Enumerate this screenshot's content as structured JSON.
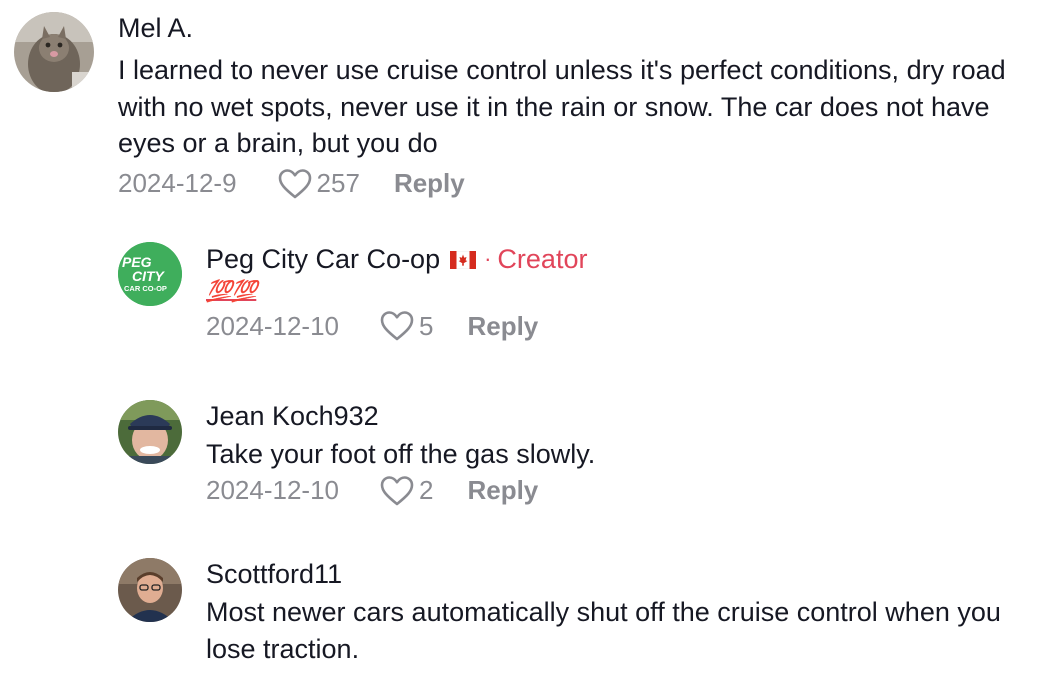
{
  "comments": [
    {
      "username": "Mel A.",
      "text": "I learned to never use cruise control unless it's perfect conditions, dry road with no wet spots, never use it in the rain or snow. The car does not have eyes or a brain, but you do",
      "date": "2024-12-9",
      "likes": "257",
      "reply_label": "Reply"
    },
    {
      "username": "Peg City Car Co-op",
      "dot": "·",
      "badge": "Creator",
      "avatar_text_line1": "PEG",
      "avatar_text_line2": "CITY",
      "avatar_text_line3": "CAR CO-OP",
      "text": "💯💯",
      "date": "2024-12-10",
      "likes": "5",
      "reply_label": "Reply"
    },
    {
      "username": "Jean Koch932",
      "text": "Take your foot off the gas slowly.",
      "date": "2024-12-10",
      "likes": "2",
      "reply_label": "Reply"
    },
    {
      "username": "Scottford11",
      "text": "Most newer cars automatically shut off the cruise control when you lose traction.",
      "date": "",
      "likes": "",
      "reply_label": ""
    }
  ],
  "colors": {
    "text": "#161823",
    "meta": "#8a8b91",
    "creator": "#e1455a",
    "coop_green": "#3fae5c"
  },
  "icons": {
    "like": "heart-outline-icon",
    "flag": "canada-flag-icon"
  }
}
